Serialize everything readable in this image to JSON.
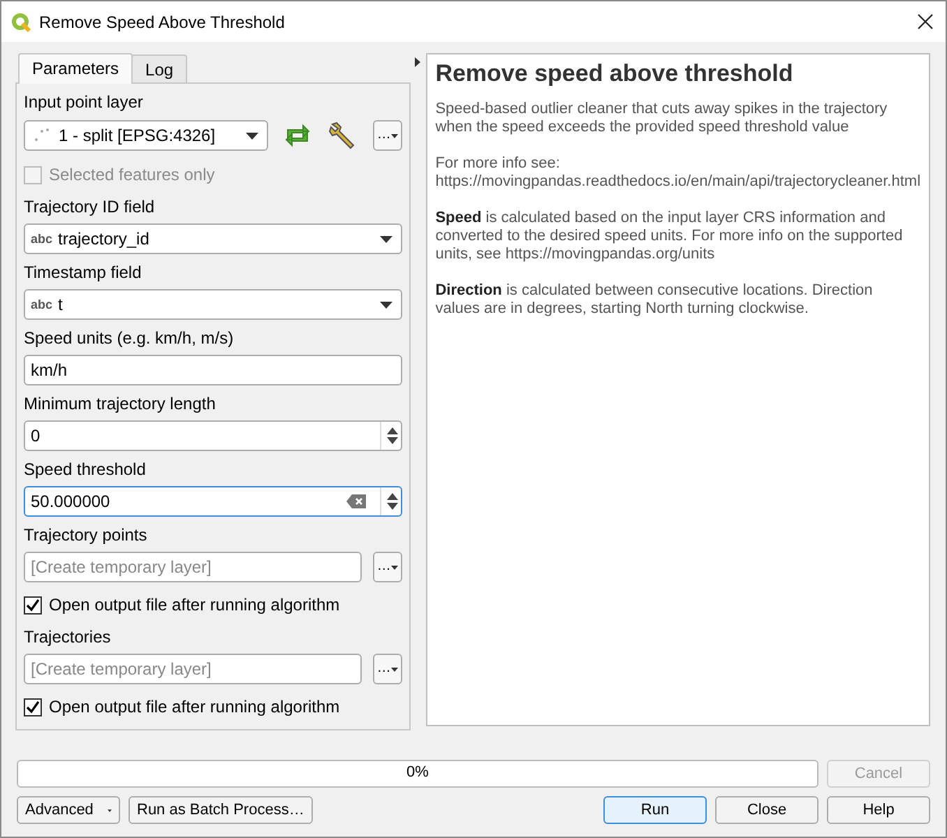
{
  "window": {
    "title": "Remove Speed Above Threshold"
  },
  "tabs": [
    {
      "label": "Parameters",
      "selected": true
    },
    {
      "label": "Log",
      "selected": false
    }
  ],
  "parameters": [
    {
      "kind": "layer_select",
      "label": "Input point layer",
      "value": "1 - split [EPSG:4326]",
      "browse": "…"
    },
    {
      "kind": "checkbox",
      "label": "Selected features only",
      "checked": false,
      "disabled": true
    },
    {
      "kind": "field_select",
      "label": "Trajectory ID field",
      "type_tag": "abc",
      "value": "trajectory_id"
    },
    {
      "kind": "field_select",
      "label": "Timestamp field",
      "type_tag": "abc",
      "value": "t"
    },
    {
      "kind": "text",
      "label": "Speed units (e.g. km/h, m/s)",
      "value": "km/h"
    },
    {
      "kind": "spin",
      "label": "Minimum trajectory length",
      "value": "0",
      "focused": false
    },
    {
      "kind": "spin",
      "label": "Speed threshold",
      "value": "50.000000",
      "focused": true
    },
    {
      "kind": "output",
      "label": "Trajectory points",
      "placeholder": "[Create temporary layer]",
      "browse": "…"
    },
    {
      "kind": "checkbox",
      "label": "Open output file after running algorithm",
      "checked": true,
      "disabled": false
    },
    {
      "kind": "output",
      "label": "Trajectories",
      "placeholder": "[Create temporary layer]",
      "browse": "…"
    },
    {
      "kind": "checkbox",
      "label": "Open output file after running algorithm",
      "checked": true,
      "disabled": false
    }
  ],
  "help": {
    "title": "Remove speed above threshold",
    "paragraphs": [
      "Speed-based outlier cleaner that cuts away spikes in the trajectory when the speed exceeds the provided speed threshold value",
      "For more info see: https://movingpandas.readthedocs.io/en/main/api/trajectorycleaner.html",
      "**Speed** is calculated based on the input layer CRS information and converted to the desired speed units. For more info on the supported units, see https://movingpandas.org/units",
      "**Direction** is calculated between consecutive locations. Direction values are in degrees, starting North turning clockwise."
    ]
  },
  "progress": {
    "level": 0,
    "text": "0%"
  },
  "cancel": {
    "label": "Cancel",
    "disabled": true
  },
  "buttons_left": [
    {
      "label": "Advanced",
      "kind": "menu"
    },
    {
      "label": "Run as Batch Process…",
      "kind": "plain"
    }
  ],
  "buttons_right": [
    {
      "label": "Run",
      "default": true
    },
    {
      "label": "Close",
      "default": false
    },
    {
      "label": "Help",
      "default": false
    }
  ]
}
